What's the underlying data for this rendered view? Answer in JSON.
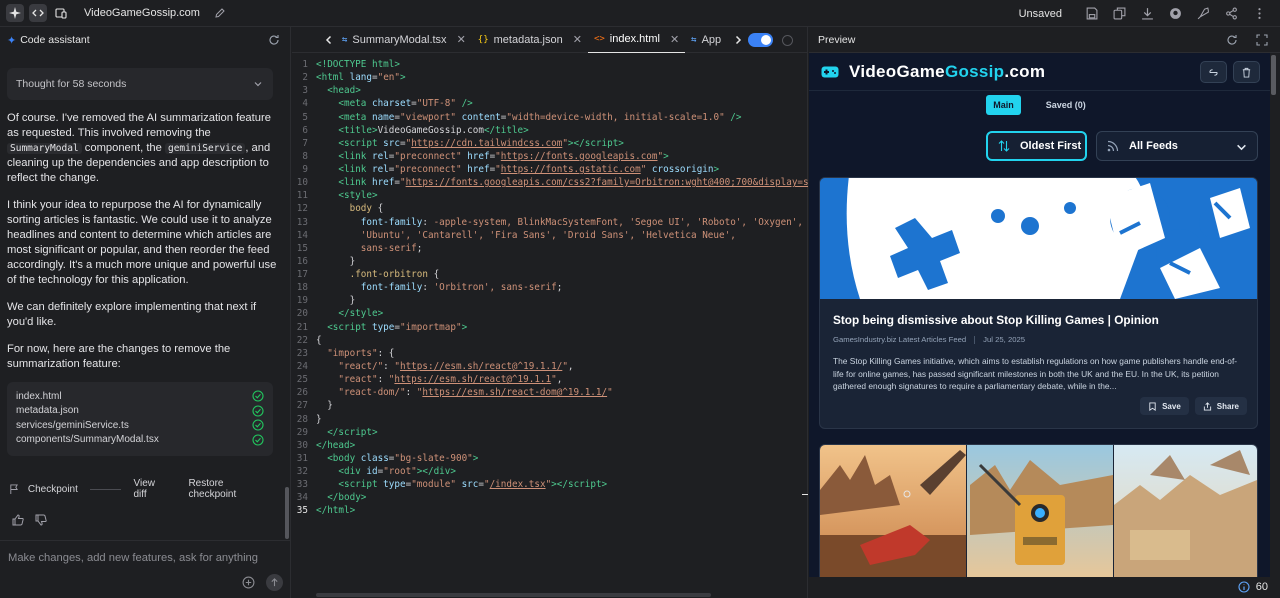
{
  "topbar": {
    "app_title": "VideoGameGossip.com",
    "status": "Unsaved"
  },
  "left_panel": {
    "title": "Code assistant",
    "thought": "Thought for 58 seconds",
    "messages": {
      "p1_a": "Of course. I've removed the AI summarization feature as requested. This involved removing the ",
      "p1_code1": "SummaryModal",
      "p1_b": " component, the ",
      "p1_code2": "geminiService",
      "p1_c": ", and cleaning up the dependencies and app description to reflect the change.",
      "p2": "I think your idea to repurpose the AI for dynamically sorting articles is fantastic. We could use it to analyze headlines and content to determine which articles are most significant or popular, and then reorder the feed accordingly. It's a much more unique and powerful use of the technology for this application.",
      "p3": "We can definitely explore implementing that next if you'd like.",
      "p4": "For now, here are the changes to remove the summarization feature:"
    },
    "changed_files": [
      "index.html",
      "metadata.json",
      "services/geminiService.ts",
      "components/SummaryModal.tsx"
    ],
    "checkpoint": {
      "label": "Checkpoint",
      "view_diff": "View diff",
      "restore": "Restore checkpoint"
    },
    "composer_placeholder": "Make changes, add new features, ask for anything"
  },
  "editor": {
    "tabs": [
      {
        "icon": "tsx",
        "label": "SummaryModal.tsx"
      },
      {
        "icon": "json",
        "label": "metadata.json"
      },
      {
        "icon": "html",
        "label": "index.html",
        "active": true
      },
      {
        "icon": "tsx",
        "label": "App"
      }
    ],
    "current_line": 35
  },
  "preview": {
    "panel_title": "Preview",
    "site_title_a": "VideoGame",
    "site_title_b": "Gossip",
    "site_title_c": ".com",
    "nav": [
      "Main",
      "Saved (0)"
    ],
    "sort_label": "Oldest First",
    "feed_label": "All Feeds",
    "articles": [
      {
        "title": "Stop being dismissive about Stop Killing Games | Opinion",
        "source": "GamesIndustry.biz Latest Articles Feed",
        "date": "Jul 25, 2025",
        "description": "The Stop Killing Games initiative, which aims to establish regulations on how game publishers handle end-of-life for online games, has passed significant milestones in both the UK and the EU. In the UK, its petition gathered enough signatures to require a parliamentary debate, while in the...",
        "save_label": "Save",
        "share_label": "Share"
      }
    ],
    "status_count": "60"
  },
  "colors": {
    "accent": "#22d3ee",
    "site_bg": "#0f172a",
    "card_bg": "#1a2436",
    "hero_blue": "#1d74d0",
    "check_green": "#22c55e",
    "toggle_blue": "#3b82f6"
  }
}
